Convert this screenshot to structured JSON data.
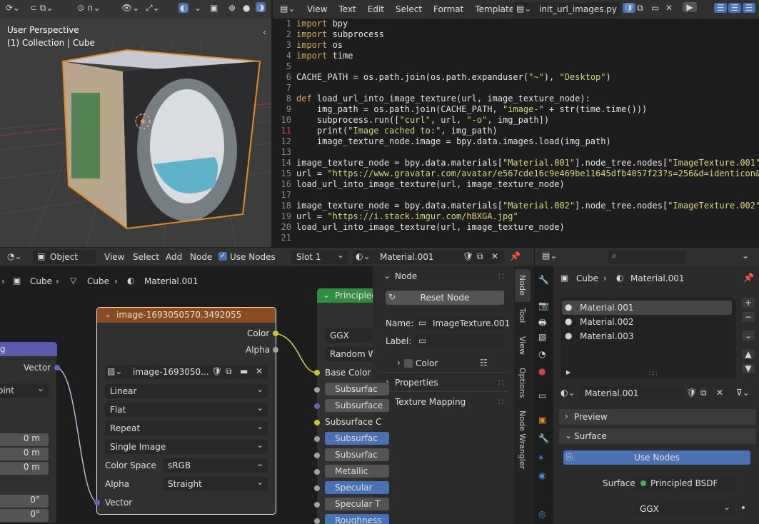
{
  "viewport": {
    "title": "User Perspective",
    "collection": "(1) Collection | Cube"
  },
  "text_editor": {
    "menu": [
      "View",
      "Text",
      "Edit",
      "Select",
      "Format",
      "Templates"
    ],
    "filename": "init_url_images.py",
    "lines": [
      {
        "n": "1",
        "parts": [
          [
            "kw",
            "import"
          ],
          [
            "",
            "bpy"
          ]
        ]
      },
      {
        "n": "2",
        "parts": [
          [
            "kw",
            "import"
          ],
          [
            "",
            "subprocess"
          ]
        ]
      },
      {
        "n": "3",
        "parts": [
          [
            "kw",
            "import"
          ],
          [
            "",
            "os"
          ]
        ]
      },
      {
        "n": "4",
        "parts": [
          [
            "kw",
            "import"
          ],
          [
            "",
            "time"
          ]
        ]
      },
      {
        "n": "5",
        "parts": []
      },
      {
        "n": "6",
        "parts": [
          [
            "",
            "CACHE_PATH = os.path.join(os.path.expanduser("
          ],
          [
            "str",
            "\"~\""
          ],
          [
            "",
            "), "
          ],
          [
            "str",
            "\"Desktop\""
          ],
          [
            "",
            ")"
          ]
        ]
      },
      {
        "n": "7",
        "parts": []
      },
      {
        "n": "8",
        "parts": [
          [
            "kw",
            "def"
          ],
          [
            "",
            "load_url_into_image_texture(url, image_texture_node):"
          ]
        ]
      },
      {
        "n": "9",
        "parts": [
          [
            "",
            "    img_path = os.path.join(CACHE_PATH, "
          ],
          [
            "str",
            "\"image-\""
          ],
          [
            "",
            " + str(time.time()))"
          ]
        ]
      },
      {
        "n": "10",
        "parts": [
          [
            "",
            "    subprocess.run(["
          ],
          [
            "str",
            "\"curl\""
          ],
          [
            "",
            ", url, "
          ],
          [
            "str",
            "\"-o\""
          ],
          [
            "",
            ", img_path])"
          ]
        ]
      },
      {
        "n": "11",
        "parts": [
          [
            "",
            "    print("
          ],
          [
            "str",
            "\"Image cached to:\""
          ],
          [
            "",
            ", img_path)"
          ]
        ]
      },
      {
        "n": "12",
        "parts": [
          [
            "",
            "    image_texture_node.image = bpy.data.images.load(img_path)"
          ]
        ]
      },
      {
        "n": "13",
        "parts": []
      },
      {
        "n": "14",
        "parts": [
          [
            "",
            "image_texture_node = bpy.data.materials["
          ],
          [
            "str",
            "\"Material.001\""
          ],
          [
            "",
            "].node_tree.nodes["
          ],
          [
            "str",
            "\"ImageTexture.001\""
          ],
          [
            "",
            "]"
          ]
        ]
      },
      {
        "n": "15",
        "parts": [
          [
            "",
            "url = "
          ],
          [
            "str",
            "\"https://www.gravatar.com/avatar/e567cde16c9e469be11645dfb4057f23?s=256&d=identicon&r="
          ]
        ]
      },
      {
        "n": "16",
        "parts": [
          [
            "",
            "load_url_into_image_texture(url, image_texture_node)"
          ]
        ]
      },
      {
        "n": "17",
        "parts": []
      },
      {
        "n": "18",
        "parts": [
          [
            "",
            "image_texture_node = bpy.data.materials["
          ],
          [
            "str",
            "\"Material.002\""
          ],
          [
            "",
            "].node_tree.nodes["
          ],
          [
            "str",
            "\"ImageTexture.002\""
          ],
          [
            "",
            "]"
          ]
        ]
      },
      {
        "n": "19",
        "parts": [
          [
            "",
            "url = "
          ],
          [
            "str",
            "\"https://i.stack.imgur.com/hBXGA.jpg\""
          ]
        ]
      },
      {
        "n": "20",
        "parts": [
          [
            "",
            "load_url_into_image_texture(url, image_texture_node)"
          ]
        ]
      },
      {
        "n": "21",
        "parts": []
      }
    ]
  },
  "node_editor": {
    "type": "Object",
    "menu": [
      "View",
      "Select",
      "Add",
      "Node"
    ],
    "use_nodes": "Use Nodes",
    "slot": "Slot 1",
    "material": "Material.001",
    "breadcrumb": [
      "Cube",
      "Cube",
      "Material.001"
    ],
    "image_node": {
      "title": "image-1693050570.3492055",
      "out_color": "Color",
      "out_alpha": "Alpha",
      "image_name": "image-1693050...",
      "interp": "Linear",
      "proj": "Flat",
      "ext": "Repeat",
      "source": "Single Image",
      "cs_label": "Color Space",
      "cs_value": "sRGB",
      "alpha_label": "Alpha",
      "alpha_value": "Straight",
      "in_vector": "Vector"
    },
    "left_node": {
      "letter": "g",
      "vector": "Vector",
      "point": "oint",
      "m1": "0 m",
      "m2": "0 m",
      "m3": "0 m",
      "d1": "0°",
      "d2": "0°"
    },
    "principled": {
      "title": "Principled",
      "ggx": "GGX",
      "random": "Random W",
      "base_color": "Base Color",
      "rows": [
        "Subsurfac",
        "Subsurface",
        "Subsurface C",
        "Subsurfac",
        "Subsurfac",
        "Metallic",
        "Specular",
        "Specular T",
        "Roughness"
      ]
    }
  },
  "sidebar": {
    "node_header": "Node",
    "reset": "Reset Node",
    "name_label": "Name:",
    "name_value": "ImageTexture.001",
    "label_label": "Label:",
    "color": "Color",
    "properties": "Properties",
    "texture_mapping": "Texture Mapping",
    "tabs": [
      "Node",
      "Tool",
      "View",
      "Options",
      "Node Wrangler"
    ]
  },
  "properties": {
    "breadcrumb_obj": "Cube",
    "breadcrumb_mat": "Material.001",
    "slots": [
      "Material.001",
      "Material.002",
      "Material.003"
    ],
    "material": "Material.001",
    "preview": "Preview",
    "surface_header": "Surface",
    "use_nodes": "Use Nodes",
    "surface_label": "Surface",
    "surface_value": "Principled BSDF",
    "ggx": "GGX"
  }
}
